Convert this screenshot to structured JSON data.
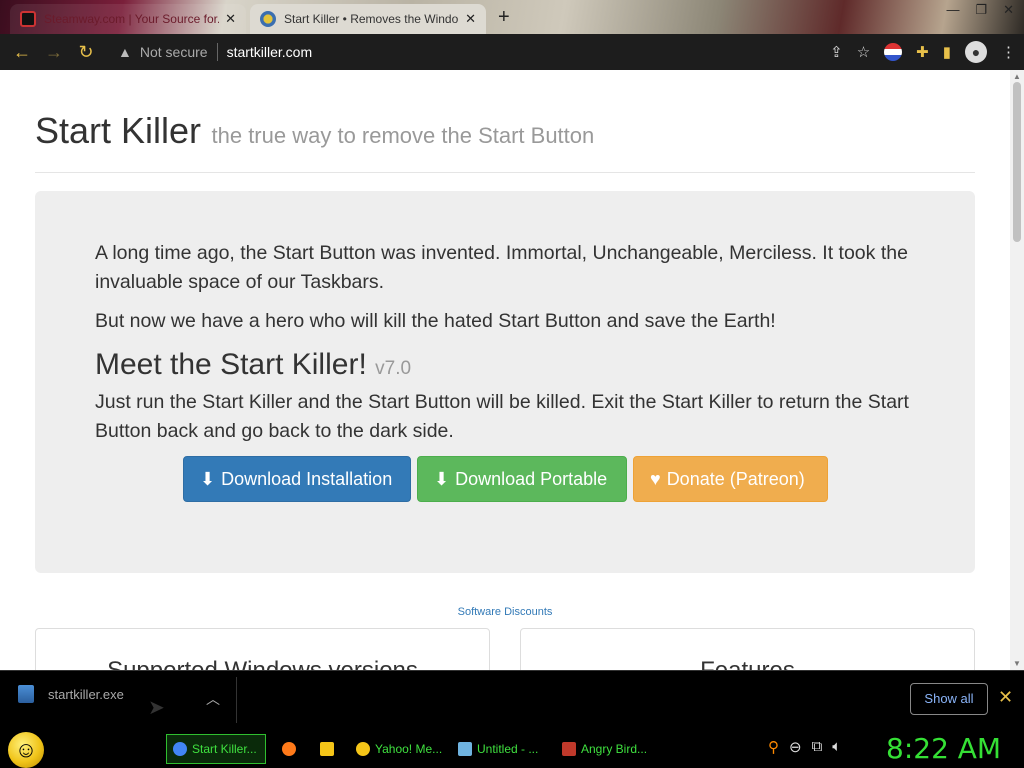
{
  "browser": {
    "tabs": [
      {
        "title": "Steamway.com | Your Source for...",
        "active": false
      },
      {
        "title": "Start Killer • Removes the Windo",
        "active": true
      }
    ],
    "new_tab_symbol": "+",
    "not_secure_label": "Not secure",
    "url": "startkiller.com"
  },
  "page": {
    "title": "Start Killer",
    "subtitle": "the true way to remove the Start Button",
    "intro_1": "A long time ago, the Start Button was invented. Immortal, Unchangeable, Merciless. It took the invaluable space of our Taskbars.",
    "intro_2": "But now we have a hero who will kill the hated Start Button and save the Earth!",
    "meet_heading": "Meet the Start Killer!",
    "version": "v7.0",
    "run_text": "Just run the Start Killer and the Start Button will be killed. Exit the Start Killer to return the Start Button back and go back to the dark side.",
    "buttons": {
      "install": "Download Installation",
      "portable": "Download Portable",
      "donate": "Donate (Patreon)"
    },
    "discounts_link": "Software Discounts",
    "panel_left": "Supported Windows versions",
    "panel_right": "Features"
  },
  "download_bar": {
    "filename": "startkiller.exe",
    "show_all": "Show all"
  },
  "taskbar": {
    "items": [
      {
        "label": "Start Killer...",
        "icon_color": "#4285f4",
        "active": true
      },
      {
        "label": "",
        "icon_color": "#ff7a1a",
        "active": false
      },
      {
        "label": "",
        "icon_color": "#f5c518",
        "active": false
      },
      {
        "label": "Yahoo! Me...",
        "icon_color": "#f5c518",
        "active": false
      },
      {
        "label": "Untitled - ...",
        "icon_color": "#6fb3e0",
        "active": false
      },
      {
        "label": "Angry Bird...",
        "icon_color": "#c0392b",
        "active": false
      }
    ],
    "clock": "8:22 AM"
  },
  "colors": {
    "primary": "#337ab7",
    "success": "#5cb85c",
    "warning": "#f0ad4e",
    "clock_green": "#35e035"
  }
}
